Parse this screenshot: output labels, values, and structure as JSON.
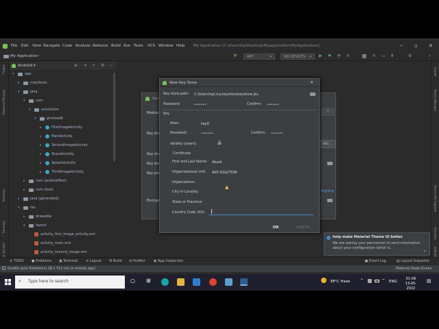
{
  "colors": {
    "ide_bg": "#2b2b2b",
    "dialog_bg": "#3c3f41",
    "accent_blue": "#4a88c7",
    "android_green": "#78c257",
    "taskbar_bg": "#1f1f2e"
  },
  "menubar": {
    "items": [
      "File",
      "Edit",
      "View",
      "Navigate",
      "Code",
      "Analyze",
      "Refactor",
      "Build",
      "Run",
      "Tools",
      "VCS",
      "Window",
      "Help"
    ],
    "window_title": "My Application [C:\\Users\\hp\\Desktop\\Myapplication\\MyApplication]"
  },
  "navbar": {
    "project_name": "My Application",
    "run_config": "APP",
    "device": "NO DEVICES"
  },
  "project_panel": {
    "view_mode": "Android",
    "tree": [
      {
        "label": "app",
        "kind": "folder",
        "indent": 0,
        "arrow": "▾"
      },
      {
        "label": "manifests",
        "kind": "folder",
        "indent": 1,
        "arrow": "▸"
      },
      {
        "label": "java",
        "kind": "folder",
        "indent": 1,
        "arrow": "▾"
      },
      {
        "label": "com",
        "kind": "folder",
        "indent": 2,
        "arrow": "▾"
      },
      {
        "label": "avsolution",
        "kind": "folder",
        "indent": 3,
        "arrow": "▾"
      },
      {
        "label": "photoedit",
        "kind": "folder",
        "indent": 4,
        "arrow": "▾"
      },
      {
        "label": "FirstImageActivity",
        "kind": "class",
        "indent": 5,
        "arrow": "▸"
      },
      {
        "label": "MainActivity",
        "kind": "class",
        "indent": 5,
        "arrow": "▸"
      },
      {
        "label": "SecondImageActivity",
        "kind": "class",
        "indent": 5,
        "arrow": "▸"
      },
      {
        "label": "ShareActivity",
        "kind": "class",
        "indent": 5,
        "arrow": "▸"
      },
      {
        "label": "SplashActivity",
        "kind": "class",
        "indent": 5,
        "arrow": "▸"
      },
      {
        "label": "ThirdImageActivity",
        "kind": "class",
        "indent": 5,
        "arrow": "▸"
      },
      {
        "label": "com (androidTest)",
        "kind": "folder",
        "indent": 2,
        "arrow": "▸"
      },
      {
        "label": "com (test)",
        "kind": "folder",
        "indent": 2,
        "arrow": "▸"
      },
      {
        "label": "java (generated)",
        "kind": "folder",
        "indent": 1,
        "arrow": "▸"
      },
      {
        "label": "res",
        "kind": "folder",
        "indent": 1,
        "arrow": "▾"
      },
      {
        "label": "drawable",
        "kind": "folder",
        "indent": 2,
        "arrow": "▸"
      },
      {
        "label": "layout",
        "kind": "folder",
        "indent": 2,
        "arrow": "▾"
      },
      {
        "label": "activity_first_image_activity.xml",
        "kind": "xml",
        "indent": 3,
        "arrow": ""
      },
      {
        "label": "activity_main.xml",
        "kind": "xml",
        "indent": 3,
        "arrow": ""
      },
      {
        "label": "activity_second_image.xml",
        "kind": "xml",
        "indent": 3,
        "arrow": ""
      }
    ]
  },
  "left_strip": [
    "Project",
    "Resource Manager",
    "Structure",
    "Favorites",
    "Build Variants"
  ],
  "right_strip": [
    "Gradle",
    "Device Manager",
    "Device File Explorer",
    "Emulator",
    "ADB Wi-Fi"
  ],
  "bg_dialog": {
    "title": "Gen",
    "labels": [
      "Module",
      "Key store",
      "Key store",
      "Key alias",
      "Key pass",
      "Encrypt"
    ],
    "btn_partial": "ING...",
    "signing_link": "Signing"
  },
  "dialog": {
    "title": "New Key Store",
    "key_store_path_label": "Key store path:",
    "key_store_path_value": "C:\\Users\\hp\\.my.keystore\\keystore.jks",
    "password_label": "Password:",
    "password_value": "••••••",
    "confirm_label": "Confirm:",
    "confirm_value": "••••••",
    "key_section": "Key",
    "alias_label": "Alias:",
    "alias_value": "key0",
    "key_password_label": "Password:",
    "key_password_value": "••••••",
    "key_confirm_label": "Confirm:",
    "key_confirm_value": "••••••",
    "validity_label": "Validity (years):",
    "validity_value": "25",
    "certificate_section": "Certificate",
    "first_last_label": "First and Last Name:",
    "first_last_value": "Akash",
    "org_unit_label": "Organizational Unit:",
    "org_unit_value": "AVS SOLUTION",
    "organization_label": "Organization:",
    "organization_value": "",
    "city_label": "City or Locality:",
    "city_value": "",
    "state_label": "State or Province:",
    "state_value": "",
    "country_label": "Country Code (XX):",
    "country_value": "",
    "ok_label": "OK",
    "cancel_label": "CANCEL"
  },
  "bottom_tabs": [
    "TODO",
    "Problems",
    "Terminal",
    "Logcat",
    "Build",
    "Profiler",
    "App Inspection",
    "Event Log",
    "Layout Inspector"
  ],
  "status": {
    "message": "Gradle sync finished in 28 s 712 ms (a minute ago)"
  },
  "notification": {
    "title": "help make Material Theme UI better",
    "body": "We are asking your permission to send information about your configuration (what is..."
  },
  "status_right": {
    "theme": "Material Deep Ocean"
  },
  "taskbar": {
    "search_placeholder": "Type here to search",
    "weather": "38°C  Haze",
    "lang": "ENG",
    "time": "01:09",
    "date": "13-05-2022"
  }
}
